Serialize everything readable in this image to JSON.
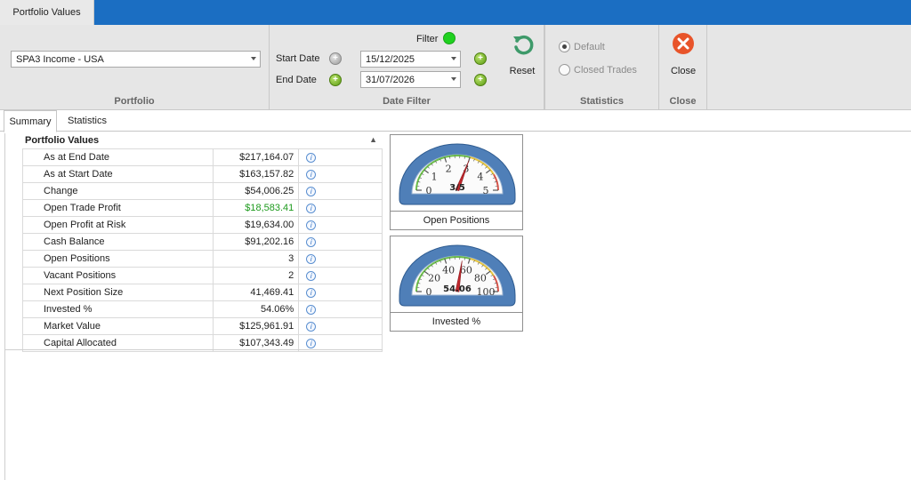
{
  "window": {
    "tab_label": "Portfolio Values"
  },
  "ribbon": {
    "portfolio": {
      "selected": "SPA3 Income - USA",
      "caption": "Portfolio"
    },
    "date_filter": {
      "filter_label": "Filter",
      "start_label": "Start Date",
      "start_value": "15/12/2025",
      "end_label": "End Date",
      "end_value": "31/07/2026",
      "caption": "Date Filter"
    },
    "reset": {
      "label": "Reset"
    },
    "statistics": {
      "option_default": "Default",
      "option_closed": "Closed Trades",
      "selected": "Default",
      "caption": "Statistics"
    },
    "close": {
      "label": "Close",
      "caption": "Close"
    }
  },
  "subtabs": [
    {
      "label": "Summary"
    },
    {
      "label": "Statistics"
    }
  ],
  "grid": {
    "title": "Portfolio Values",
    "rows": [
      {
        "name": "As at End Date",
        "value": "$217,164.07"
      },
      {
        "name": "As at Start Date",
        "value": "$163,157.82"
      },
      {
        "name": "Change",
        "value": "$54,006.25"
      },
      {
        "name": "Open Trade Profit",
        "value": "$18,583.41"
      },
      {
        "name": "Open Profit at Risk",
        "value": "$19,634.00"
      },
      {
        "name": "Cash Balance",
        "value": "$91,202.16"
      },
      {
        "name": "Open Positions",
        "value": "3"
      },
      {
        "name": "Vacant Positions",
        "value": "2"
      },
      {
        "name": "Next Position Size",
        "value": "41,469.41"
      },
      {
        "name": "Invested %",
        "value": "54.06%"
      },
      {
        "name": "Market Value",
        "value": "$125,961.91"
      },
      {
        "name": "Capital Allocated",
        "value": "$107,343.49"
      }
    ],
    "info_glyph": "i"
  },
  "gauges": [
    {
      "caption": "Open Positions",
      "readout": "3/5",
      "value": 3,
      "min": 0,
      "max": 5,
      "ticks": [
        "0",
        "1",
        "2",
        "3",
        "4",
        "5"
      ]
    },
    {
      "caption": "Invested %",
      "readout": "54.06",
      "value": 54.06,
      "min": 0,
      "max": 100,
      "ticks": [
        "0",
        "20",
        "40",
        "60",
        "80",
        "100"
      ]
    }
  ],
  "colors": {
    "accent": "#1b6ec2",
    "positive": "#1d9a1d",
    "filter_active": "#1fd11f",
    "close": "#e8542a",
    "reset": "#3e9a6a",
    "gauge_face": "#4f7fb8"
  }
}
